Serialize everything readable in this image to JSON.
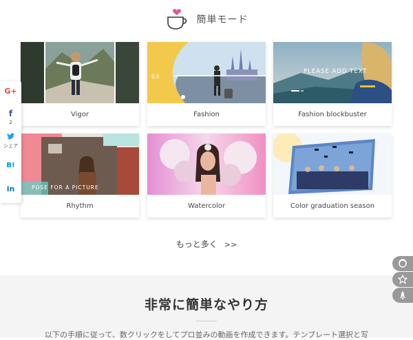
{
  "header": {
    "title": "簡単モード",
    "logo_icon": "heart-cup-icon"
  },
  "templates": [
    {
      "label": "Vigor",
      "thumb_text": ""
    },
    {
      "label": "Fashion",
      "thumb_text": "03"
    },
    {
      "label": "Fashion blockbuster",
      "thumb_text": "PLEASE ADD TEXT"
    },
    {
      "label": "Rhythm",
      "thumb_text": "POSE FOR A PICTURE"
    },
    {
      "label": "Watercolor",
      "thumb_text": ""
    },
    {
      "label": "Color graduation season",
      "thumb_text": ""
    }
  ],
  "more": {
    "label": "もっと多く",
    "arrow": ">>"
  },
  "how_to": {
    "heading": "非常に簡単なやり方",
    "description": "以下の手順に従って、数クリックをしてプロ並みの動画を作成できます。テンプレート選択と写"
  },
  "share_bar": {
    "google_label": "G+",
    "facebook_label": "f",
    "facebook_count": "2",
    "twitter_caption": "シェア",
    "hatena_label": "B!",
    "linkedin_label": "in"
  },
  "float_buttons": [
    "support-icon",
    "star-icon",
    "rocket-icon"
  ],
  "colors": {
    "brand_pink": "#e0569a",
    "fashion_yellow": "#f3c94b"
  }
}
